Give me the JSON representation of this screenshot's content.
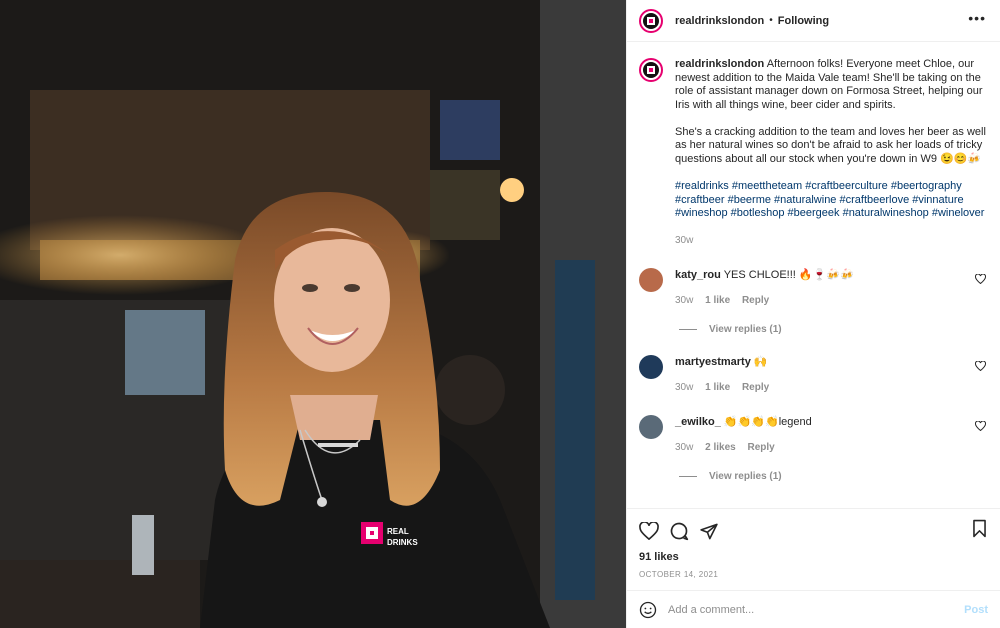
{
  "post": {
    "username": "realdrinkslondon",
    "separator": "•",
    "follow_status": "Following",
    "more_icon": "more-horizontal-icon"
  },
  "caption": {
    "username": "realdrinkslondon",
    "paragraph1": "Afternoon folks! Everyone meet Chloe, our newest addition to the Maida Vale team! She'll be taking on the role of assistant manager down on Formosa Street, helping our Iris with all things wine, beer cider and spirits.",
    "paragraph2": "She's a cracking addition to the team and loves her beer as well as her natural wines so don't be afraid to ask her loads of tricky questions about all our stock when you're down in W9 😉😊🍻",
    "hashtags": "#realdrinks #meettheteam #craftbeerculture #beertography #craftbeer #beerme #naturalwine #craftbeerlove #vinnature #wineshop #botleshop #beergeek #naturalwineshop #winelover",
    "time": "30w"
  },
  "comments": [
    {
      "username": "katy_rou",
      "text": "YES CHLOE!!! 🔥🍷🍻🍻",
      "time": "30w",
      "likes": "1 like",
      "reply": "Reply",
      "view_replies": "View replies (1)",
      "avatar_color": "#b86a4a"
    },
    {
      "username": "martyestmarty",
      "text": "🙌",
      "time": "30w",
      "likes": "1 like",
      "reply": "Reply",
      "view_replies": "",
      "avatar_color": "#1f3a5a"
    },
    {
      "username": "_ewilko_",
      "text": "👏👏👏👏legend",
      "time": "30w",
      "likes": "2 likes",
      "reply": "Reply",
      "view_replies": "View replies (1)",
      "avatar_color": "#5a6a78"
    }
  ],
  "actions": {
    "like_icon": "heart-icon",
    "comment_icon": "comment-icon",
    "share_icon": "send-icon",
    "save_icon": "bookmark-icon",
    "likes": "91 likes",
    "date": "OCTOBER 14, 2021"
  },
  "add_comment": {
    "emoji_icon": "emoji-icon",
    "placeholder": "Add a comment...",
    "post_label": "Post"
  },
  "colors": {
    "brand": "#e6006f",
    "link": "#00376b",
    "muted": "#8e8e8e",
    "post_disabled": "#b2dffc"
  }
}
